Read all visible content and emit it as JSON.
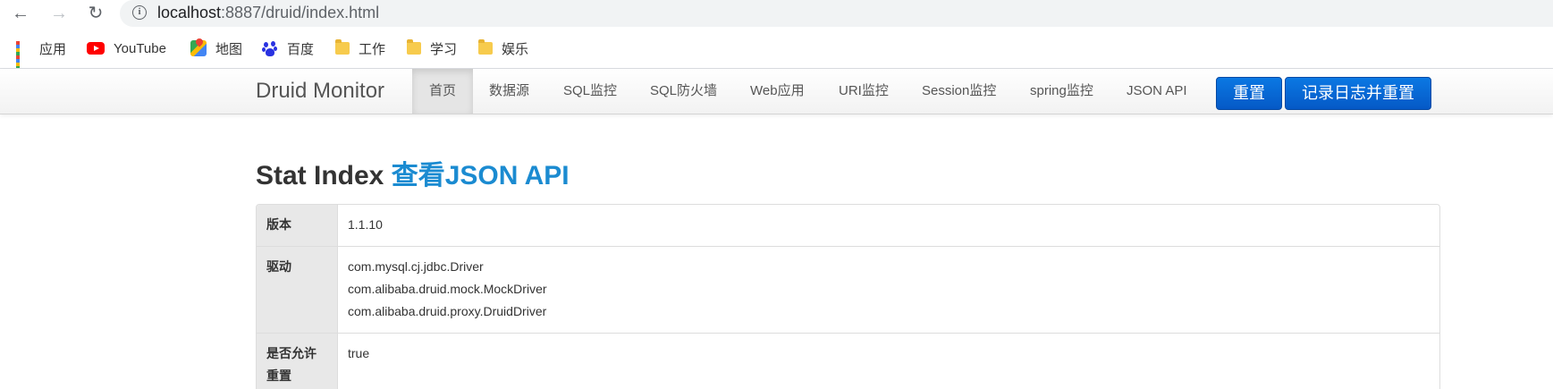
{
  "browser": {
    "url_host": "localhost",
    "url_rest": ":8887/druid/index.html",
    "bookmarks": [
      {
        "label": "应用",
        "icon": "apps-grid-icon"
      },
      {
        "label": "YouTube",
        "icon": "youtube-icon"
      },
      {
        "label": "地图",
        "icon": "maps-icon"
      },
      {
        "label": "百度",
        "icon": "baidu-icon"
      },
      {
        "label": "工作",
        "icon": "folder-icon"
      },
      {
        "label": "学习",
        "icon": "folder-icon"
      },
      {
        "label": "娱乐",
        "icon": "folder-icon"
      }
    ]
  },
  "navbar": {
    "brand": "Druid Monitor",
    "items": [
      "首页",
      "数据源",
      "SQL监控",
      "SQL防火墙",
      "Web应用",
      "URI监控",
      "Session监控",
      "spring监控",
      "JSON API"
    ],
    "active_index": 0,
    "buttons": {
      "reset": "重置",
      "log_and_reset": "记录日志并重置"
    }
  },
  "page": {
    "title": "Stat Index ",
    "title_link": "查看JSON API"
  },
  "stat_table": [
    {
      "key": "版本",
      "values": [
        "1.1.10"
      ]
    },
    {
      "key": "驱动",
      "values": [
        "com.mysql.cj.jdbc.Driver",
        "com.alibaba.druid.mock.MockDriver",
        "com.alibaba.druid.proxy.DruidDriver"
      ]
    },
    {
      "key": "是否允许重置",
      "values": [
        "true"
      ]
    }
  ],
  "colors": {
    "brand_blue": "#1b8bd1",
    "button_blue": "#0668d6",
    "youtube_red": "#ff0000",
    "folder_yellow": "#f7cb4d"
  }
}
